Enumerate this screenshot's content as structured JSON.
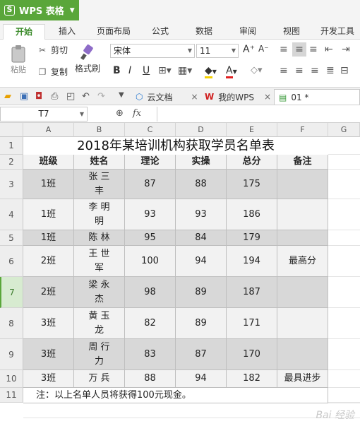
{
  "app": {
    "name": "WPS 表格",
    "logo": "S"
  },
  "tabs": [
    "开始",
    "插入",
    "页面布局",
    "公式",
    "数据",
    "审阅",
    "视图",
    "开发工具"
  ],
  "ribbon": {
    "paste": "粘贴",
    "cut": "剪切",
    "copy": "复制",
    "format_painter": "格式刷",
    "font_name": "宋体",
    "font_size": "11"
  },
  "doctabs": {
    "cloud": "云文档",
    "mywps": "我的WPS",
    "current": "01 *"
  },
  "formula": {
    "cell_ref": "T7",
    "fx": "fx"
  },
  "columns": [
    "A",
    "B",
    "C",
    "D",
    "E",
    "F",
    "G"
  ],
  "rows": [
    "1",
    "2",
    "3",
    "4",
    "5",
    "6",
    "7",
    "8",
    "9",
    "10",
    "11"
  ],
  "sheet": {
    "title": "2018年某培训机构获取学员名单表",
    "headers": [
      "班级",
      "姓名",
      "理论",
      "实操",
      "总分",
      "备注"
    ],
    "data": [
      [
        "1班",
        "张 三\n丰",
        "87",
        "88",
        "175",
        ""
      ],
      [
        "1班",
        "李 明\n明",
        "93",
        "93",
        "186",
        ""
      ],
      [
        "1班",
        "陈 林",
        "95",
        "84",
        "179",
        ""
      ],
      [
        "2班",
        "王 世\n军",
        "100",
        "94",
        "194",
        "最高分"
      ],
      [
        "2班",
        "梁 永\n杰",
        "98",
        "89",
        "187",
        ""
      ],
      [
        "3班",
        "黄 玉\n龙",
        "82",
        "89",
        "171",
        ""
      ],
      [
        "3班",
        "周 行\n力",
        "83",
        "87",
        "170",
        ""
      ],
      [
        "3班",
        "万 兵",
        "88",
        "94",
        "182",
        "最具进步"
      ]
    ],
    "note": "注：以上名单人员将获得100元现金。"
  },
  "watermark": "Bai 经验",
  "colors": {
    "accent": "#5aa63a",
    "shade": "#d8d8d8",
    "light": "#f2f2f2"
  }
}
